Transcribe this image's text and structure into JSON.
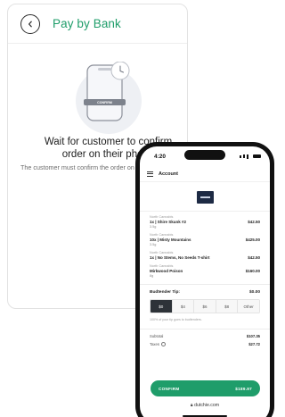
{
  "card": {
    "title": "Pay by Bank",
    "illustration_label": "CONFIRM",
    "wait_title_line1": "Wait for customer to confirm",
    "wait_title_line2": "order on their phone",
    "wait_subtitle": "The customer must confirm the order on"
  },
  "phone": {
    "time": "4:20",
    "account_label": "Account",
    "items": [
      {
        "vendor": "North Cannabis",
        "name": "1x | Shire Skunk #2",
        "price": "$42.50",
        "weight": "3.5g"
      },
      {
        "vendor": "North Cannabis",
        "name": "10x | Misty Mountains",
        "price": "$425.00",
        "weight": "3.5g"
      },
      {
        "vendor": "North Cannabis",
        "name": "1x | No Stems, No Seeds T-shirt",
        "price": "$42.50",
        "weight": ""
      },
      {
        "vendor": "North Cannabis",
        "name": "Mirkwood Poison",
        "price": "$160.00",
        "weight": "8g"
      }
    ],
    "tip": {
      "label": "Budtender Tip:",
      "amount": "$0.00",
      "options": [
        "$0",
        "$4",
        "$6",
        "$8",
        "Other"
      ],
      "selected": "$0",
      "note": "100% of your tip goes to budtenders."
    },
    "totals": {
      "subtotal_label": "Subtotal",
      "subtotal_value": "$107.35",
      "taxes_label": "Taxes",
      "taxes_value": "$27.72"
    },
    "confirm_label": "CONFIRM",
    "confirm_amount": "$189.97",
    "url": "dutchie.com"
  },
  "colors": {
    "accent": "#1f9d6a",
    "selected_tip": "#2d3238"
  }
}
